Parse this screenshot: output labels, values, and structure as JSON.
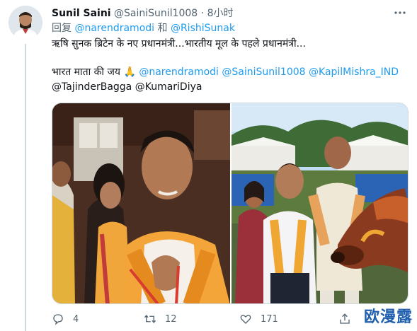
{
  "tweet": {
    "author_name": "Sunil Saini",
    "handle": "@SainiSunil1008",
    "separator": "·",
    "time": "8小时",
    "reply_prefix": "回复",
    "reply_to_1": "@narendramodi",
    "reply_joiner": "和",
    "reply_to_2": "@RishiSunak",
    "line1": "ऋषि सुनक ब्रिटेन के नए प्रधानमंत्री...भारतीय मूल के पहले प्रधानमंत्री...",
    "line2_text": "भारत माता की जय 🙏",
    "mentions_line2": "@narendramodi @SainiSunil1008 @KapilMishra_IND",
    "mentions_line3": "@TajinderBagga @KumariDiya"
  },
  "actions": {
    "reply_count": "4",
    "retweet_count": "12",
    "like_count": "171"
  },
  "icons": {
    "more": "more-dots-icon",
    "reply": "reply-bubble-icon",
    "retweet": "retweet-icon",
    "like": "heart-icon",
    "share": "share-icon"
  },
  "watermark": "欧漫露",
  "colors": {
    "link": "#1d9bf0",
    "secondary": "#536471",
    "text": "#0f1419"
  }
}
